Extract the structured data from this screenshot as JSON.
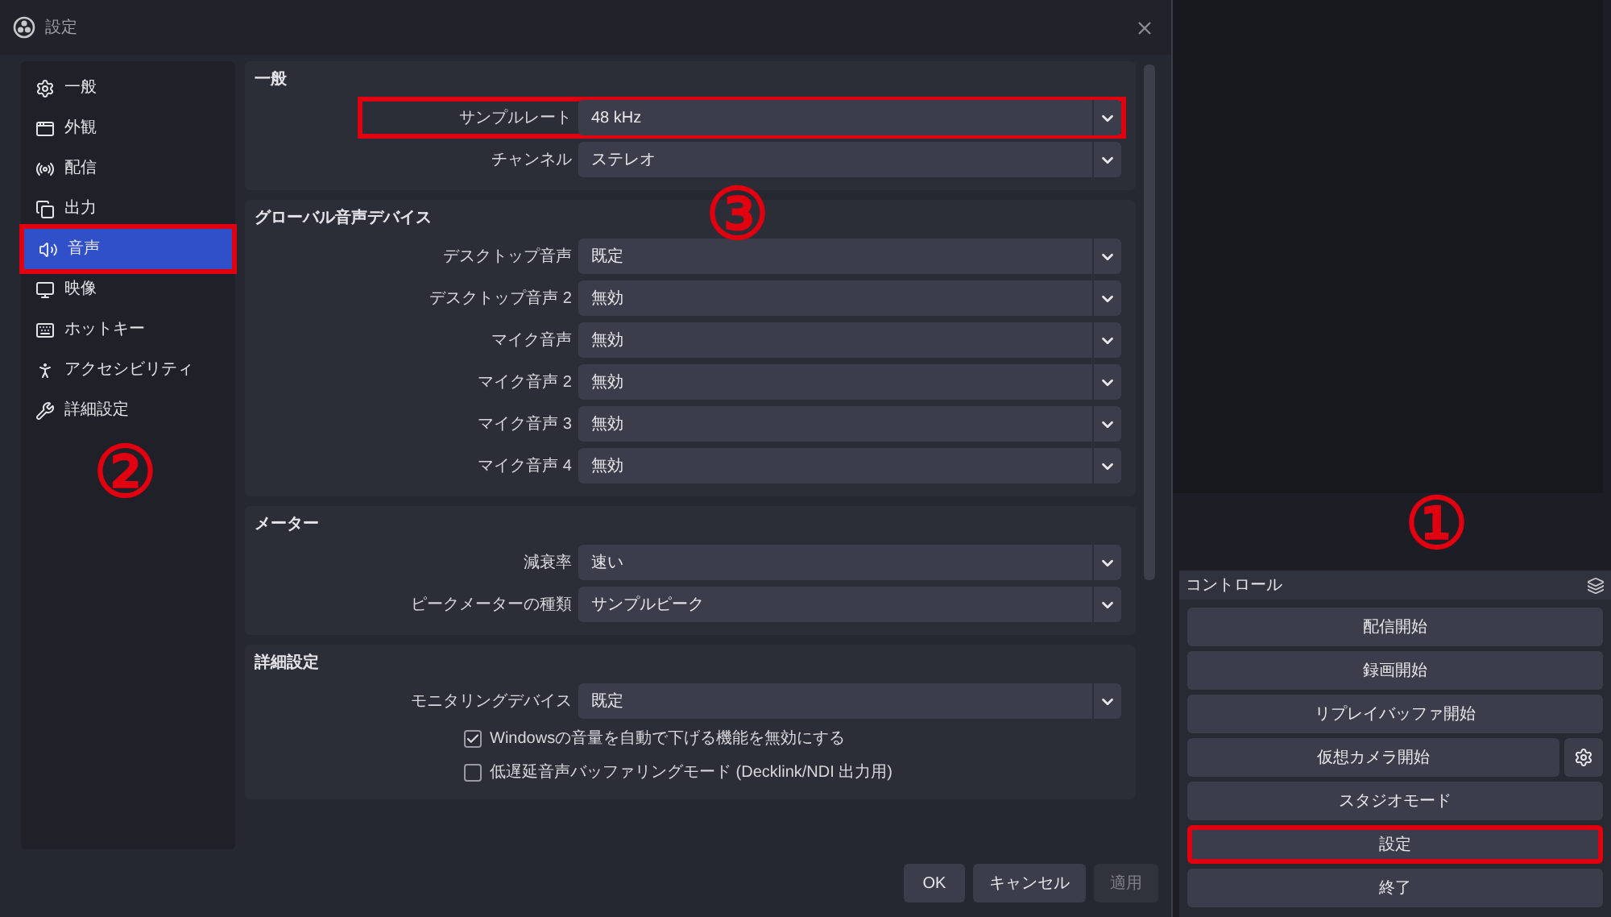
{
  "window": {
    "title": "設定"
  },
  "sidebar": {
    "items": [
      {
        "label": "一般",
        "selected": false,
        "highlighted": false
      },
      {
        "label": "外観",
        "selected": false,
        "highlighted": false
      },
      {
        "label": "配信",
        "selected": false,
        "highlighted": false
      },
      {
        "label": "出力",
        "selected": false,
        "highlighted": false
      },
      {
        "label": "音声",
        "selected": true,
        "highlighted": true
      },
      {
        "label": "映像",
        "selected": false,
        "highlighted": false
      },
      {
        "label": "ホットキー",
        "selected": false,
        "highlighted": false
      },
      {
        "label": "アクセシビリティ",
        "selected": false,
        "highlighted": false
      },
      {
        "label": "詳細設定",
        "selected": false,
        "highlighted": false
      }
    ]
  },
  "groups": [
    {
      "title": "一般",
      "rows": [
        {
          "kind": "select",
          "label": "サンプルレート",
          "value": "48 kHz",
          "highlighted": true
        },
        {
          "kind": "select",
          "label": "チャンネル",
          "value": "ステレオ",
          "highlighted": false
        }
      ]
    },
    {
      "title": "グローバル音声デバイス",
      "rows": [
        {
          "kind": "select",
          "label": "デスクトップ音声",
          "value": "既定",
          "highlighted": false
        },
        {
          "kind": "select",
          "label": "デスクトップ音声 2",
          "value": "無効",
          "highlighted": false
        },
        {
          "kind": "select",
          "label": "マイク音声",
          "value": "無効",
          "highlighted": false
        },
        {
          "kind": "select",
          "label": "マイク音声 2",
          "value": "無効",
          "highlighted": false
        },
        {
          "kind": "select",
          "label": "マイク音声 3",
          "value": "無効",
          "highlighted": false
        },
        {
          "kind": "select",
          "label": "マイク音声 4",
          "value": "無効",
          "highlighted": false
        }
      ]
    },
    {
      "title": "メーター",
      "rows": [
        {
          "kind": "select",
          "label": "減衰率",
          "value": "速い",
          "highlighted": false
        },
        {
          "kind": "select",
          "label": "ピークメーターの種類",
          "value": "サンプルピーク",
          "highlighted": false
        }
      ]
    },
    {
      "title": "詳細設定",
      "rows": [
        {
          "kind": "select",
          "label": "モニタリングデバイス",
          "value": "既定",
          "highlighted": false
        },
        {
          "kind": "checkbox",
          "label": "Windowsの音量を自動で下げる機能を無効にする",
          "checked": true
        },
        {
          "kind": "checkbox",
          "label": "低遅延音声バッファリングモード (Decklink/NDI 出力用)",
          "checked": false
        }
      ]
    }
  ],
  "dialog_buttons": [
    {
      "label": "OK",
      "disabled": false
    },
    {
      "label": "キャンセル",
      "disabled": false
    },
    {
      "label": "適用",
      "disabled": true
    }
  ],
  "controls": {
    "title": "コントロール",
    "buttons": [
      {
        "label": "配信開始",
        "has_settings": false,
        "highlighted": false
      },
      {
        "label": "録画開始",
        "has_settings": false,
        "highlighted": false
      },
      {
        "label": "リプレイバッファ開始",
        "has_settings": false,
        "highlighted": false
      },
      {
        "label": "仮想カメラ開始",
        "has_settings": true,
        "highlighted": false
      },
      {
        "label": "スタジオモード",
        "has_settings": false,
        "highlighted": false
      },
      {
        "label": "設定",
        "has_settings": false,
        "highlighted": true
      },
      {
        "label": "終了",
        "has_settings": false,
        "highlighted": false
      }
    ]
  },
  "markers": [
    "①",
    "②",
    "③"
  ]
}
